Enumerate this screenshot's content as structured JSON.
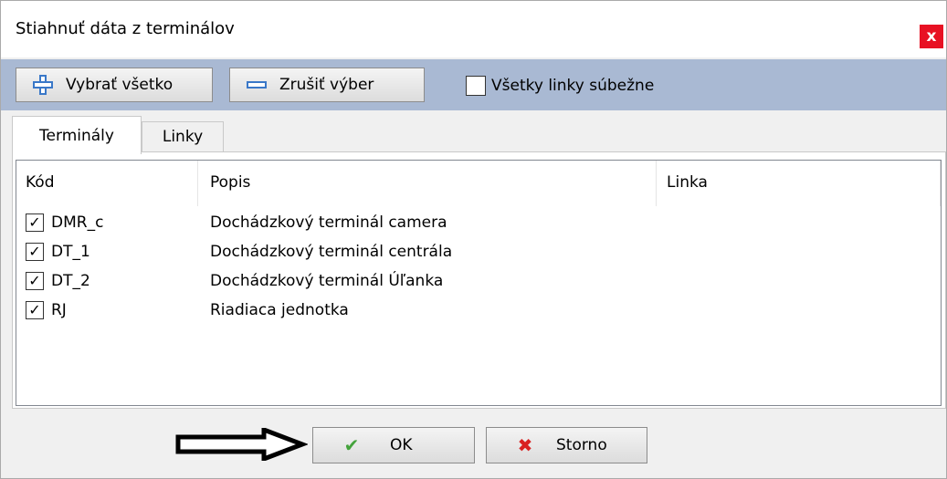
{
  "window": {
    "title": "Stiahnuť dáta z terminálov",
    "close_label": "x"
  },
  "toolbar": {
    "select_all_label": "Vybrať všetko",
    "deselect_label": "Zrušiť výber",
    "parallel_label": "Všetky linky súbežne",
    "parallel_checked": false
  },
  "tabs": [
    {
      "label": "Terminály",
      "active": true
    },
    {
      "label": "Linky",
      "active": false
    }
  ],
  "table": {
    "columns": [
      "Kód",
      "Popis",
      "Linka"
    ],
    "rows": [
      {
        "checked": true,
        "code": "DMR_c",
        "description": "Dochádzkový terminál camera",
        "line": ""
      },
      {
        "checked": true,
        "code": "DT_1",
        "description": "Dochádzkový terminál centrála",
        "line": ""
      },
      {
        "checked": true,
        "code": "DT_2",
        "description": "Dochádzkový terminál Úľanka",
        "line": ""
      },
      {
        "checked": true,
        "code": "RJ",
        "description": "Riadiaca jednotka",
        "line": ""
      }
    ]
  },
  "buttons": {
    "ok_label": "OK",
    "cancel_label": "Storno"
  },
  "colors": {
    "toolbar_bg": "#a9b9d3",
    "close_bg": "#e81123",
    "ok_icon": "#44a33c",
    "cancel_icon": "#d92020"
  },
  "icons": {
    "select_all": "plus-icon",
    "deselect": "minus-icon",
    "ok": "check-icon",
    "cancel": "x-icon",
    "pointer": "arrow-right-icon"
  }
}
